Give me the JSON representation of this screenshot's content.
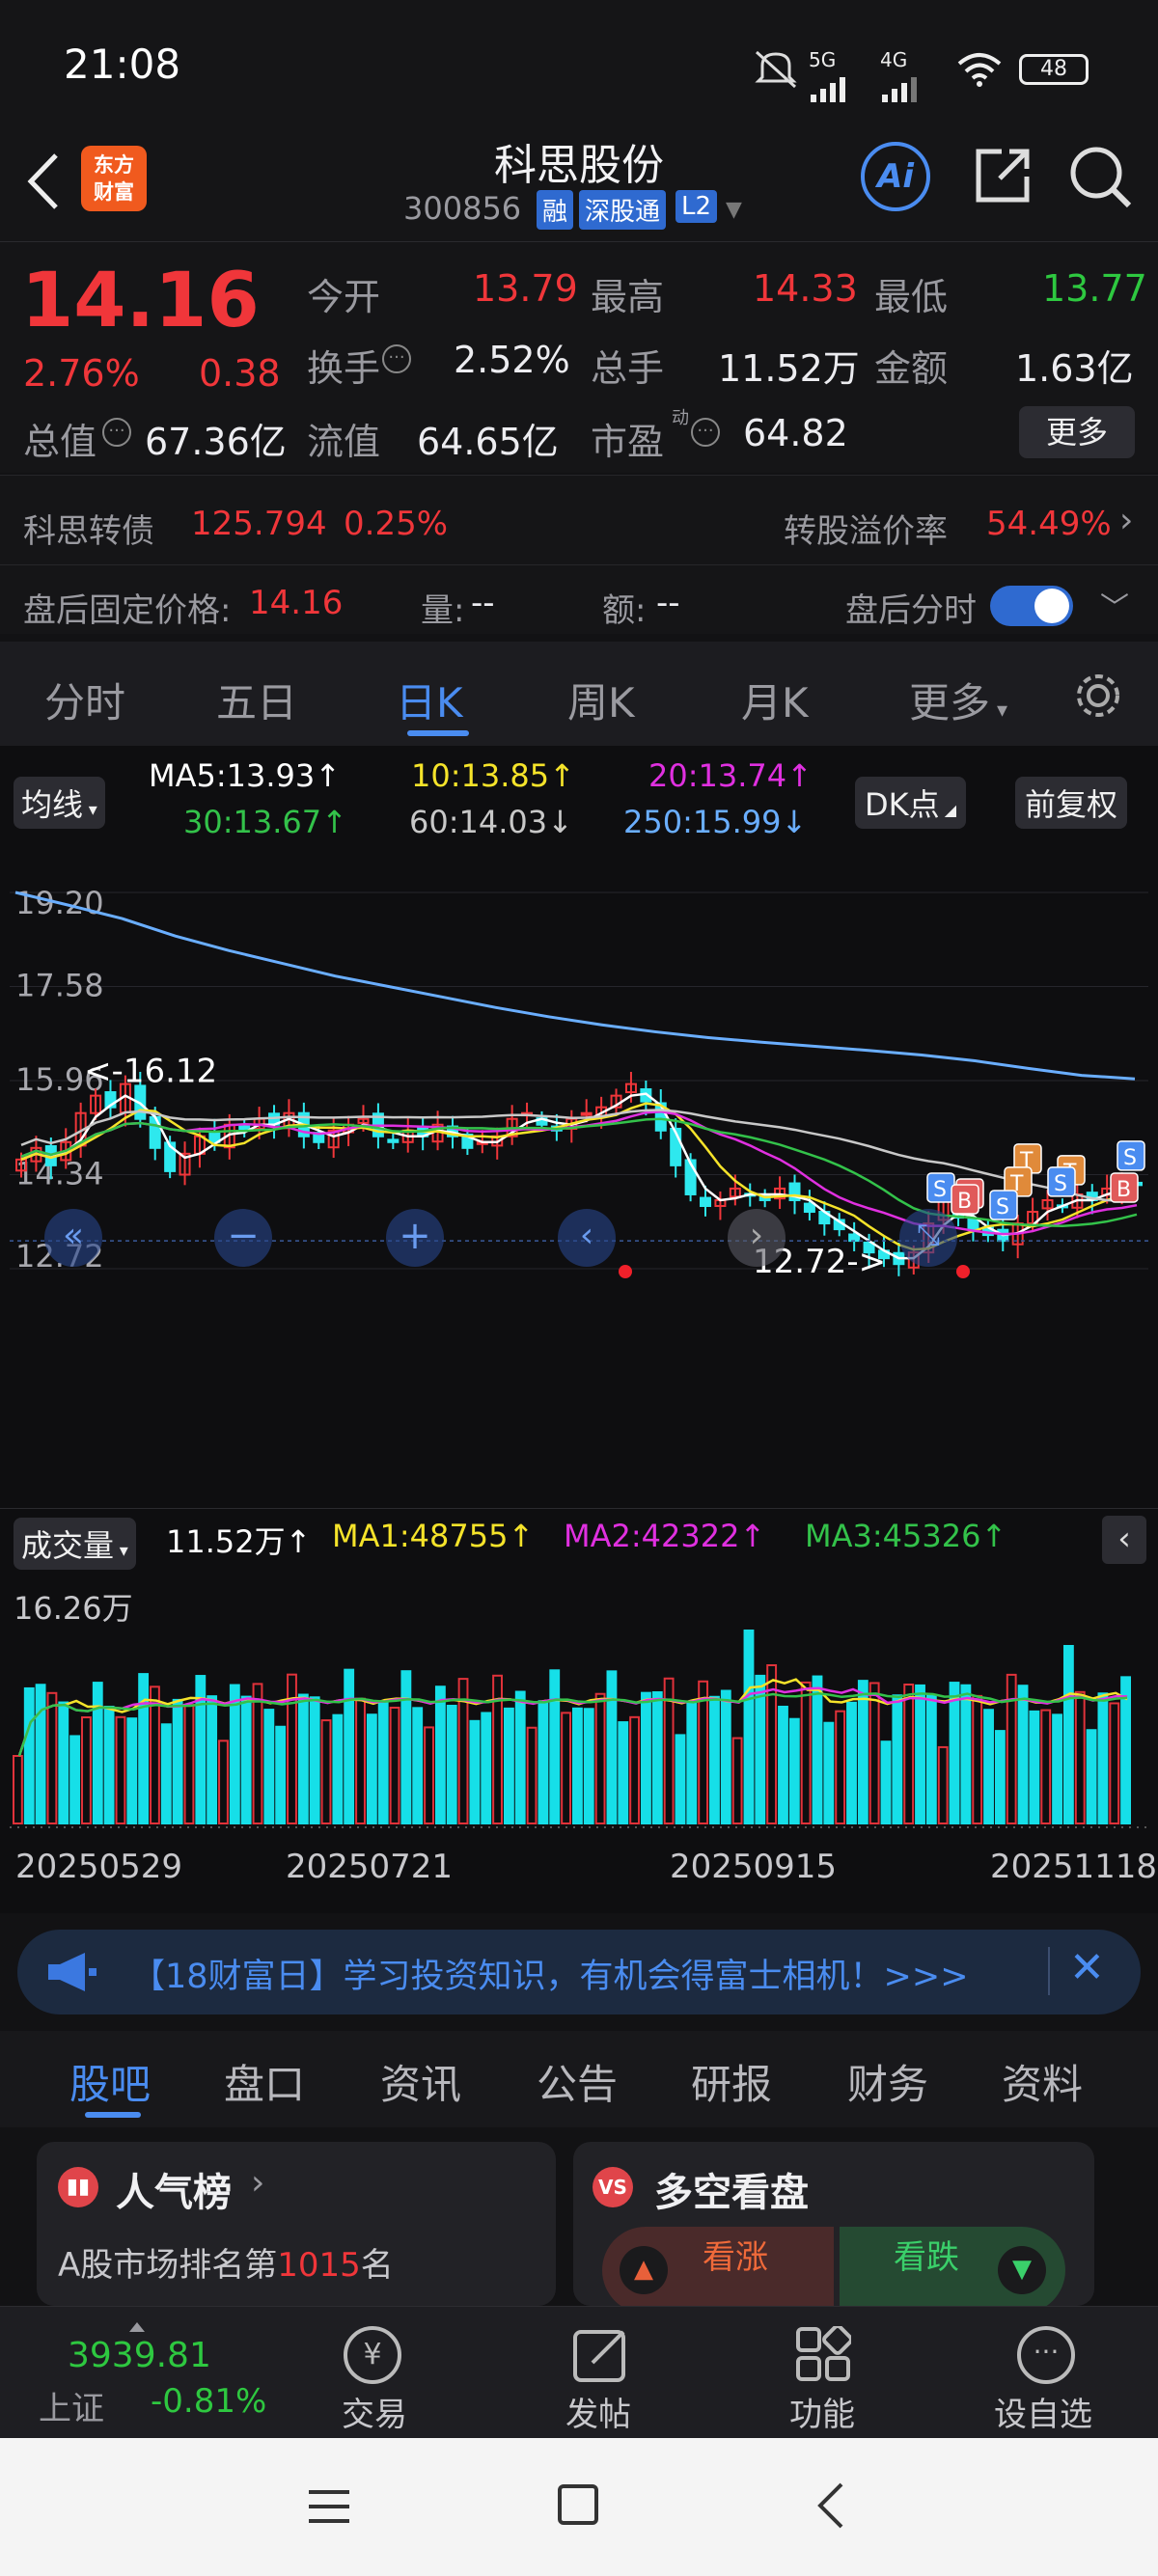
{
  "status": {
    "time": "21:08",
    "battery": "48",
    "net1": "5G",
    "net2": "4G"
  },
  "header": {
    "logo_line1": "东方",
    "logo_line2": "财富",
    "title": "科思股份",
    "code": "300856",
    "tag1": "融",
    "tag2": "深股通",
    "tag3": "L2",
    "ai": "Ai"
  },
  "quote": {
    "price": "14.16",
    "change_pct": "2.76%",
    "change": "0.38",
    "open_label": "今开",
    "open": "13.79",
    "high_label": "最高",
    "high": "14.33",
    "low_label": "最低",
    "low": "13.77",
    "turnover_label": "换手",
    "turnover": "2.52%",
    "volume_label": "总手",
    "volume": "11.52万",
    "amount_label": "金额",
    "amount": "1.63亿",
    "mktcap_label": "总值",
    "mktcap": "67.36亿",
    "float_label": "流值",
    "float": "64.65亿",
    "pe_label": "市盈",
    "pe_sup": "动",
    "pe": "64.82",
    "more": "更多"
  },
  "bond": {
    "name": "科思转债",
    "price": "125.794",
    "pct": "0.25%",
    "premium_label": "转股溢价率",
    "premium": "54.49%",
    "after_label": "盘后固定价格:",
    "after_price": "14.16",
    "vol_label": "量:",
    "vol": "--",
    "amt_label": "额:",
    "amt": "--",
    "after_time": "盘后分时"
  },
  "tabs": [
    "分时",
    "五日",
    "日K",
    "周K",
    "月K",
    "更多"
  ],
  "ma": {
    "selector": "均线",
    "ma5": "MA5:13.93",
    "ma10": "10:13.85",
    "ma20": "20:13.74",
    "ma30": "30:13.67",
    "ma60": "60:14.03",
    "ma250": "250:15.99",
    "dk": "DK点",
    "fq": "前复权"
  },
  "colors": {
    "ma5": "#ffffff",
    "ma10": "#f5e32a",
    "ma20": "#e030e0",
    "ma30": "#33c24a",
    "ma60": "#c8c8c8",
    "ma250": "#6aaeff",
    "up": "#f0363a",
    "down": "#2ee8ee"
  },
  "price_axis": [
    "19.20",
    "17.58",
    "15.96",
    "14.34",
    "12.72"
  ],
  "annotations": {
    "high": "<-16.12",
    "low": "12.72->"
  },
  "volume": {
    "selector": "成交量",
    "vol": "11.52万",
    "ma1": "MA1:48755",
    "ma2": "MA2:42322",
    "ma3": "MA3:45326",
    "max": "16.26万"
  },
  "dates": [
    "20250529",
    "20250721",
    "20250915",
    "20251118"
  ],
  "banner": {
    "text": "【18财富日】学习投资知识，有机会得富士相机！>>>"
  },
  "bottom_tabs": [
    "股吧",
    "盘口",
    "资讯",
    "公告",
    "研报",
    "财务",
    "资料"
  ],
  "cards": {
    "rank_title": "人气榜",
    "rank_pre": "A股市场排名第",
    "rank_num": "1015",
    "rank_post": "名",
    "vs_title": "多空看盘",
    "bull": "看涨",
    "bear": "看跌",
    "bull_pct": "**%",
    "bear_pct": "**%"
  },
  "footer": {
    "index_value": "3939.81",
    "index_name": "上证",
    "index_pct": "-0.81%",
    "trade": "交易",
    "post": "发帖",
    "func": "功能",
    "watch": "设自选"
  },
  "chart_data": {
    "type": "candlestick",
    "title": "科思股份 日K",
    "ylim": [
      12.72,
      19.2
    ],
    "yticks": [
      19.2,
      17.58,
      15.96,
      14.34,
      12.72
    ],
    "x_ticks": [
      "20250529",
      "20250721",
      "20250915",
      "20251118"
    ],
    "period_high": 16.12,
    "period_low": 12.72,
    "last_close": 14.16,
    "ma_values": {
      "MA5": 13.93,
      "MA10": 13.85,
      "MA20": 13.74,
      "MA30": 13.67,
      "MA60": 14.03,
      "MA250": 15.99
    },
    "ma250_path": [
      19.2,
      18.98,
      18.75,
      18.45,
      18.2,
      17.98,
      17.76,
      17.58,
      17.4,
      17.22,
      17.06,
      16.92,
      16.8,
      16.7,
      16.62,
      16.55,
      16.48,
      16.4,
      16.3,
      16.17,
      16.05,
      15.99
    ],
    "close": [
      14.6,
      14.8,
      14.5,
      14.9,
      15.4,
      15.7,
      15.5,
      15.9,
      15.3,
      14.8,
      14.4,
      14.7,
      15.0,
      14.9,
      15.2,
      15.1,
      15.3,
      15.2,
      15.4,
      15.0,
      14.9,
      15.1,
      15.2,
      15.3,
      15.0,
      14.9,
      15.1,
      15.0,
      15.2,
      15.0,
      14.8,
      14.9,
      15.0,
      15.3,
      15.4,
      15.2,
      15.1,
      15.3,
      15.4,
      15.5,
      15.7,
      15.9,
      15.6,
      15.1,
      14.5,
      14.0,
      13.8,
      13.9,
      14.1,
      14.0,
      13.9,
      14.1,
      13.9,
      13.7,
      13.5,
      13.4,
      13.2,
      13.0,
      12.9,
      12.8,
      13.0,
      13.5,
      13.9,
      13.6,
      13.4,
      13.3,
      13.2,
      13.5,
      13.7,
      13.9,
      13.8,
      14.0,
      13.9,
      14.1,
      14.2,
      14.16
    ],
    "volume_max_label": "16.26万"
  }
}
